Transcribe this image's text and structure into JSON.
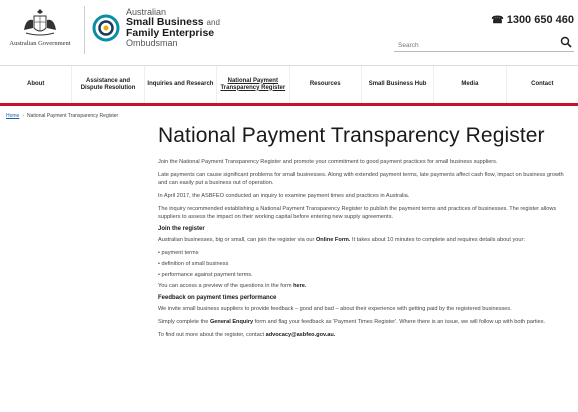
{
  "header": {
    "gov_text": "Australian Government",
    "brand": {
      "line1": "Australian",
      "line2": "Small Business",
      "line2_and": "and",
      "line3": "Family Enterprise",
      "line4": "Ombudsman"
    },
    "phone": "1300 650 460",
    "search_placeholder": "Search"
  },
  "nav": {
    "items": [
      "About",
      "Assistance and Dispute Resolution",
      "Inquiries and Research",
      "National Payment Transparency Register",
      "Resources",
      "Small Business Hub",
      "Media",
      "Contact"
    ]
  },
  "breadcrumb": {
    "home": "Home",
    "current": "National Payment Transparency Register"
  },
  "main": {
    "title": "National Payment Transparency Register",
    "p1": "Join the National Payment Transparency Register and promote your commitment to good payment practices for small business suppliers.",
    "p2": "Late payments can cause significant problems for small businesses. Along with extended payment terms, late payments affect cash flow, impact on business growth and can easily put a business out of operation.",
    "p3": "In April 2017, the ASBFEO conducted an inquiry to examine payment times and practices in Australia.",
    "p4": "The inquiry recommended establishing a National Payment Transparency Register to publish the payment terms and practices of businesses. The register allows suppliers to assess the impact on their working capital before entering new supply agreements.",
    "h_join": "Join the register",
    "p5_a": "Australian businesses, big or small, can join the register via our",
    "p5_link": "Online Form.",
    "p5_b": "It takes about 10 minutes to complete and requires details about your:",
    "list": [
      "• payment terms",
      "• definition of small business",
      "• performance against payment terms."
    ],
    "p6_a": "You can access a preview of the questions in the form",
    "p6_link": "here.",
    "h_feedback": "Feedback on payment times performance",
    "p7": "We invite small business suppliers to provide feedback – good and bad – about their experience with getting paid by the registered businesses.",
    "p8_a": "Simply complete the",
    "p8_link": "General Enquiry",
    "p8_b": "form and flag your feedback as 'Payment Times Register'. Where there is an issue, we will follow up with both parties.",
    "p9_a": "To find out more about the register, contact",
    "p9_link": "advocacy@asbfeo.gov.au."
  }
}
